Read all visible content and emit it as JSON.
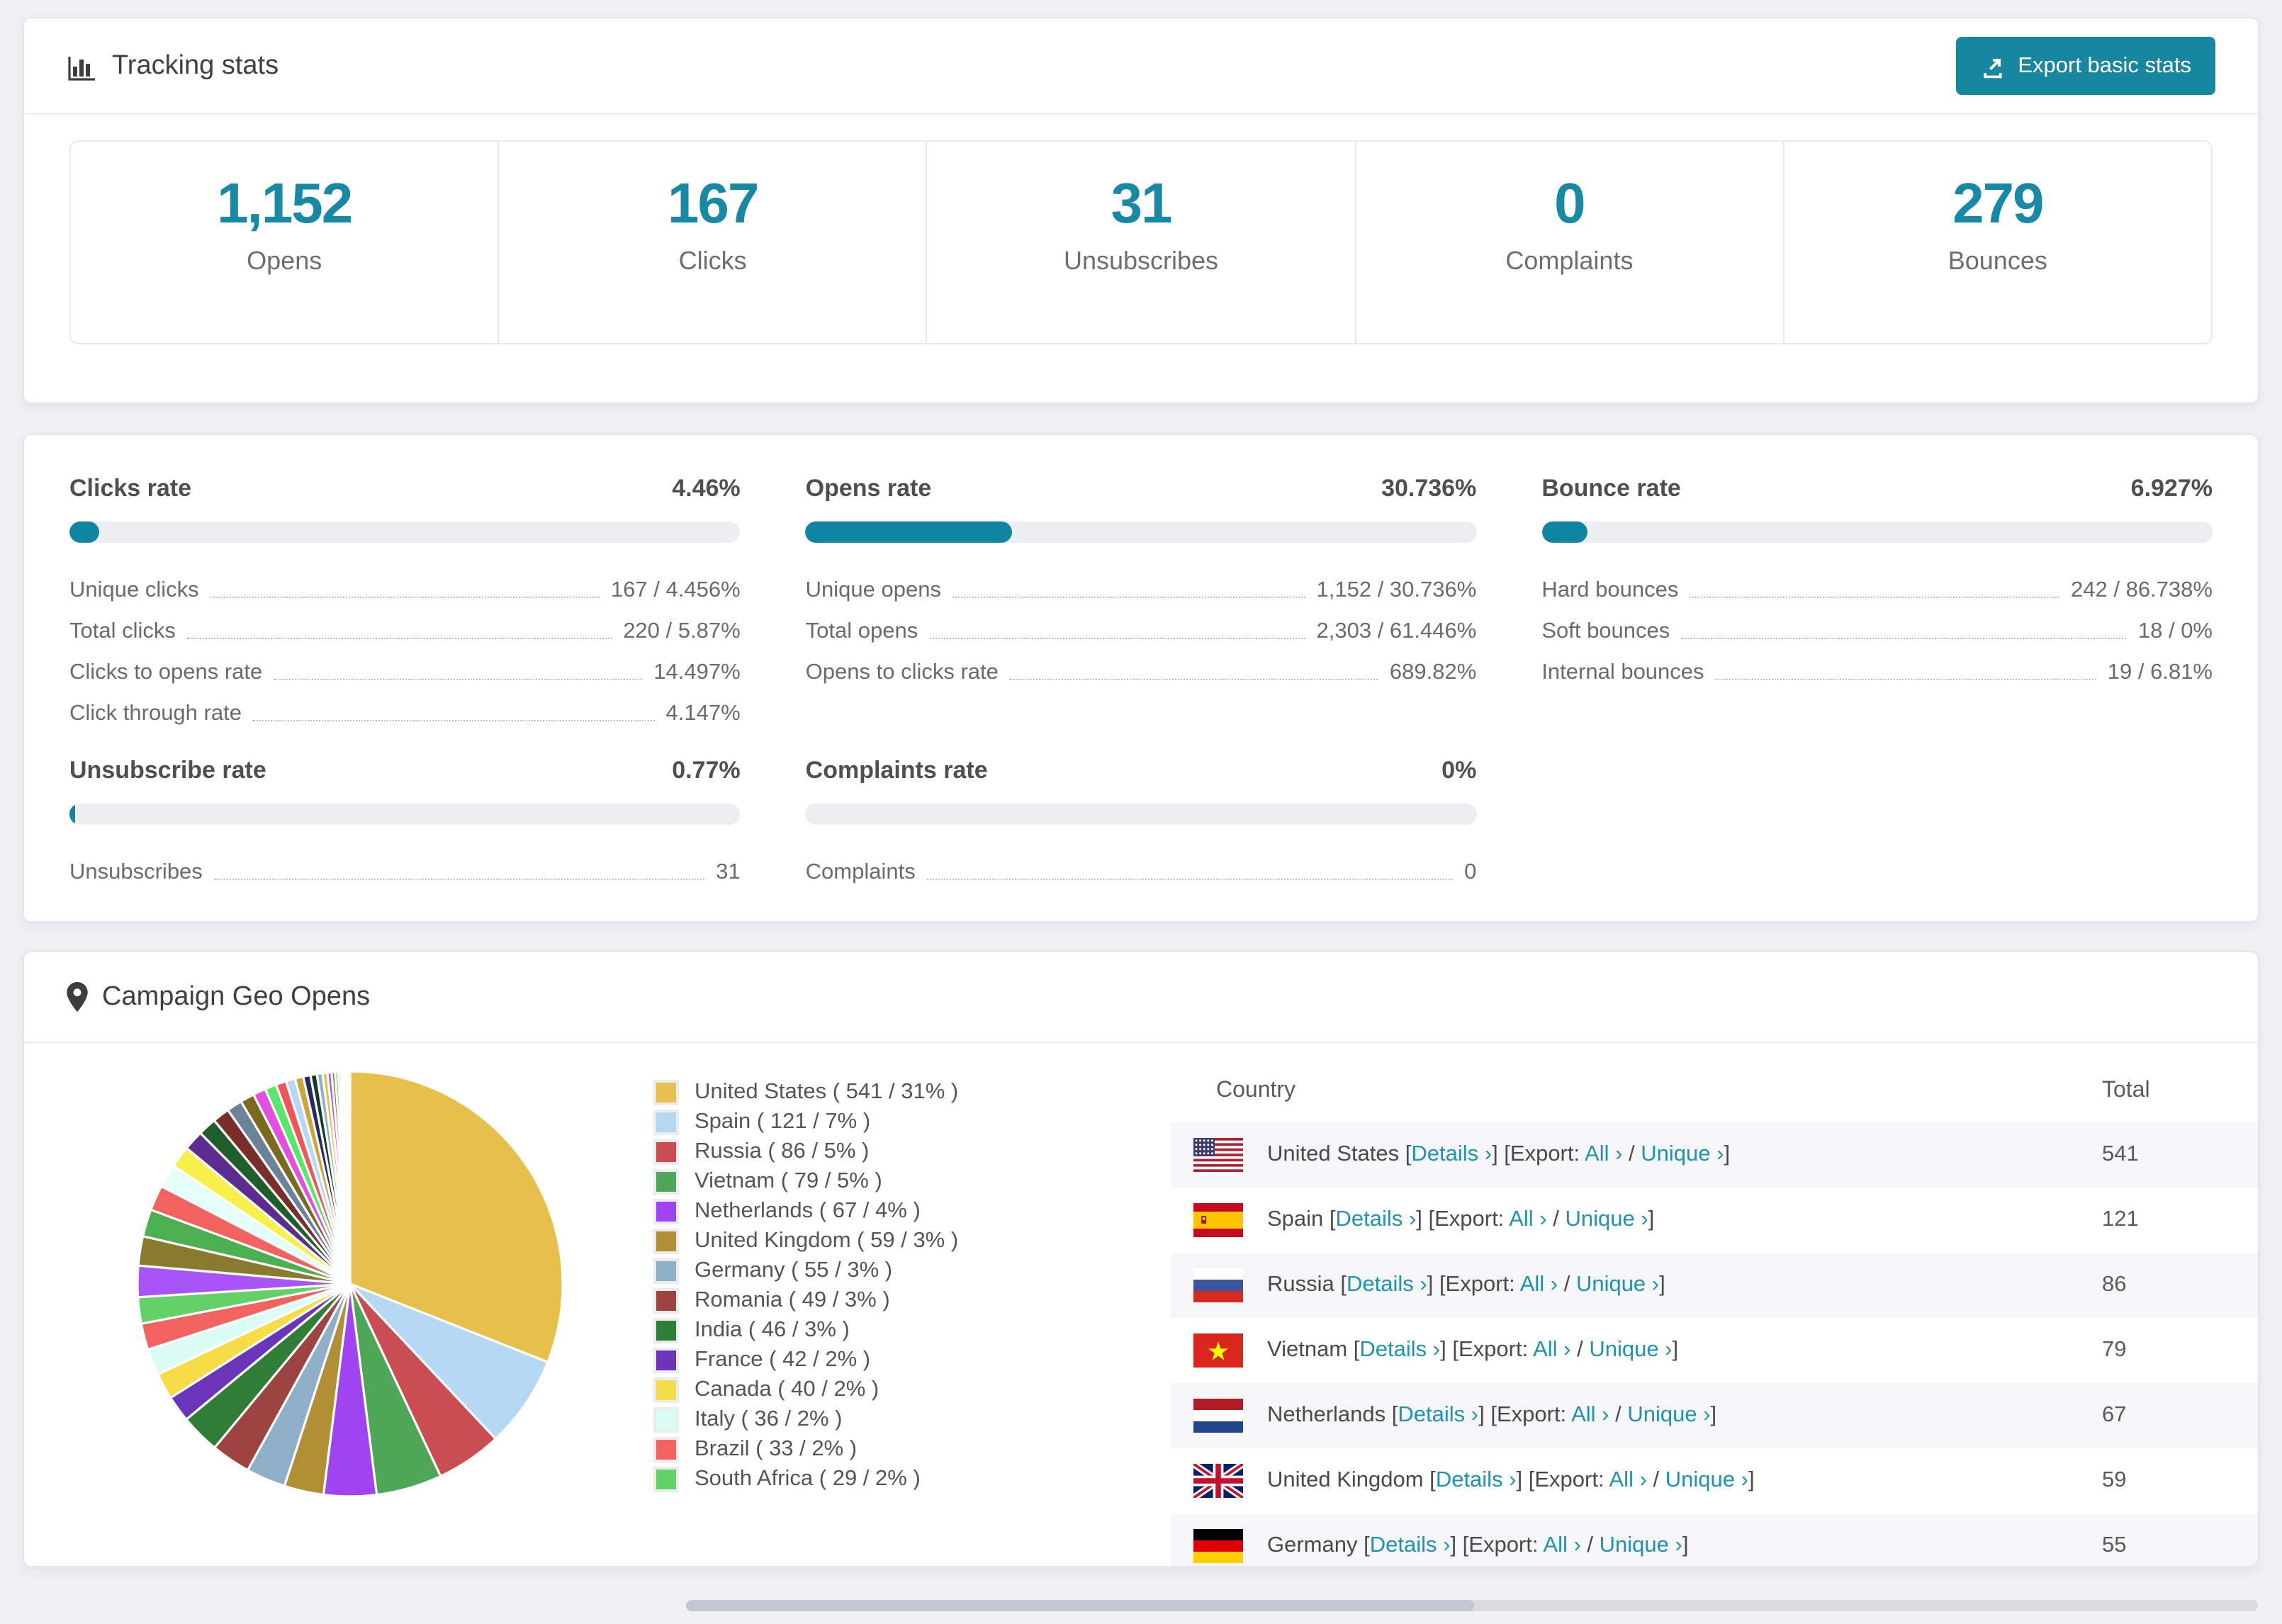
{
  "colors": {
    "accent": "#16879e",
    "link": "#1e93ad",
    "stat_number": "#1789a4",
    "bar_fill": "#0f85a3",
    "bar_track": "#eceef0",
    "row_stripe": "#f6f6f8"
  },
  "tracking": {
    "title": "Tracking stats",
    "export_button": "Export basic stats",
    "stats": [
      {
        "value": "1,152",
        "label": "Opens"
      },
      {
        "value": "167",
        "label": "Clicks"
      },
      {
        "value": "31",
        "label": "Unsubscribes"
      },
      {
        "value": "0",
        "label": "Complaints"
      },
      {
        "value": "279",
        "label": "Bounces"
      }
    ]
  },
  "rates": [
    {
      "title": "Clicks rate",
      "value": "4.46%",
      "percent": 4.46,
      "rows": [
        {
          "label": "Unique clicks",
          "value": "167 / 4.456%"
        },
        {
          "label": "Total clicks",
          "value": "220 / 5.87%"
        },
        {
          "label": "Clicks to opens rate",
          "value": "14.497%"
        },
        {
          "label": "Click through rate",
          "value": "4.147%"
        }
      ]
    },
    {
      "title": "Opens rate",
      "value": "30.736%",
      "percent": 30.736,
      "rows": [
        {
          "label": "Unique opens",
          "value": "1,152 / 30.736%"
        },
        {
          "label": "Total opens",
          "value": "2,303 / 61.446%"
        },
        {
          "label": "Opens to clicks rate",
          "value": "689.82%"
        }
      ]
    },
    {
      "title": "Bounce rate",
      "value": "6.927%",
      "percent": 6.927,
      "rows": [
        {
          "label": "Hard bounces",
          "value": "242 / 86.738%"
        },
        {
          "label": "Soft bounces",
          "value": "18 / 0%"
        },
        {
          "label": "Internal bounces",
          "value": "19 / 6.81%"
        }
      ]
    },
    {
      "title": "Unsubscribe rate",
      "value": "0.77%",
      "percent": 0.77,
      "rows": [
        {
          "label": "Unsubscribes",
          "value": "31"
        }
      ]
    },
    {
      "title": "Complaints rate",
      "value": "0%",
      "percent": 0,
      "rows": [
        {
          "label": "Complaints",
          "value": "0"
        }
      ]
    }
  ],
  "geo": {
    "title": "Campaign Geo Opens",
    "table": {
      "columns": [
        "Country",
        "Total"
      ],
      "details_label": "Details ›",
      "export_label": "Export:",
      "all_label": "All ›",
      "unique_label": "Unique ›",
      "rows": [
        {
          "country": "United States",
          "flag": "us",
          "total": "541"
        },
        {
          "country": "Spain",
          "flag": "es",
          "total": "121"
        },
        {
          "country": "Russia",
          "flag": "ru",
          "total": "86"
        },
        {
          "country": "Vietnam",
          "flag": "vn",
          "total": "79"
        },
        {
          "country": "Netherlands",
          "flag": "nl",
          "total": "67"
        },
        {
          "country": "United Kingdom",
          "flag": "gb",
          "total": "59"
        },
        {
          "country": "Germany",
          "flag": "de",
          "total": "55"
        }
      ]
    }
  },
  "chart_data": {
    "type": "pie",
    "title": "Campaign Geo Opens",
    "legend_position": "right",
    "start_angle_deg": -90,
    "direction": "clockwise",
    "slices": [
      {
        "label": "United States",
        "value": 541,
        "percent": 31,
        "color": "#e7bf4b"
      },
      {
        "label": "Spain",
        "value": 121,
        "percent": 7,
        "color": "#b5d8f3"
      },
      {
        "label": "Russia",
        "value": 86,
        "percent": 5,
        "color": "#c94d52"
      },
      {
        "label": "Vietnam",
        "value": 79,
        "percent": 5,
        "color": "#4ea757"
      },
      {
        "label": "Netherlands",
        "value": 67,
        "percent": 4,
        "color": "#a044f2"
      },
      {
        "label": "United Kingdom",
        "value": 59,
        "percent": 3,
        "color": "#b18f35"
      },
      {
        "label": "Germany",
        "value": 55,
        "percent": 3,
        "color": "#8fafc8"
      },
      {
        "label": "Romania",
        "value": 49,
        "percent": 3,
        "color": "#9e4440"
      },
      {
        "label": "India",
        "value": 46,
        "percent": 3,
        "color": "#2f7d36"
      },
      {
        "label": "France",
        "value": 42,
        "percent": 2,
        "color": "#6a35b8"
      },
      {
        "label": "Canada",
        "value": 40,
        "percent": 2,
        "color": "#f6dd47"
      },
      {
        "label": "Italy",
        "value": 36,
        "percent": 2,
        "color": "#dbfcf4"
      },
      {
        "label": "Brazil",
        "value": 33,
        "percent": 2,
        "color": "#f2625e"
      },
      {
        "label": "South Africa",
        "value": 29,
        "percent": 2,
        "color": "#62d167"
      }
    ],
    "others": {
      "percent": 26,
      "count": 32,
      "palette": [
        "#a855f7",
        "#8a7a2e",
        "#4caf50",
        "#f2635f",
        "#e4fffa",
        "#f7ef4a",
        "#5b2d91",
        "#1d5e2a",
        "#7a2e2a",
        "#6b8399",
        "#7a6a1e",
        "#e44fe0",
        "#57e86b",
        "#f25555",
        "#b5d8f3",
        "#caa53a",
        "#28286e",
        "#123d2a",
        "#8fafc8",
        "#e7bf4b"
      ]
    }
  }
}
